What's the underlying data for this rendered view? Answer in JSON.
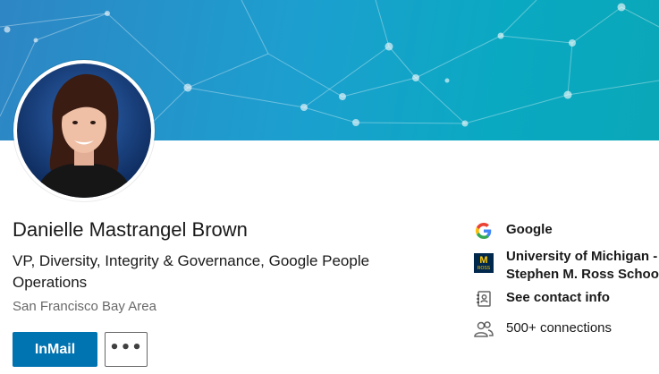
{
  "profile": {
    "name": "Danielle Mastrangel Brown",
    "headline": "VP, Diversity, Integrity & Governance, Google People Operations",
    "location": "San Francisco Bay Area"
  },
  "actions": {
    "inmail_label": "InMail",
    "more_label": "•••"
  },
  "sidebar": {
    "company": {
      "icon": "google-g-logo",
      "label": "Google"
    },
    "school": {
      "icon": "michigan-ross-logo",
      "line1": "University of Michigan -",
      "line2": "Stephen M. Ross School of",
      "logo_text_top": "M",
      "logo_text_bottom": "ROSS"
    },
    "contact": {
      "icon": "contact-card-icon",
      "label": "See contact info"
    },
    "connections": {
      "icon": "people-icon",
      "label": "500+ connections"
    }
  },
  "colors": {
    "primary_button": "#0073b1",
    "banner_start": "#2e86c4",
    "banner_end": "#0aa7b8"
  }
}
